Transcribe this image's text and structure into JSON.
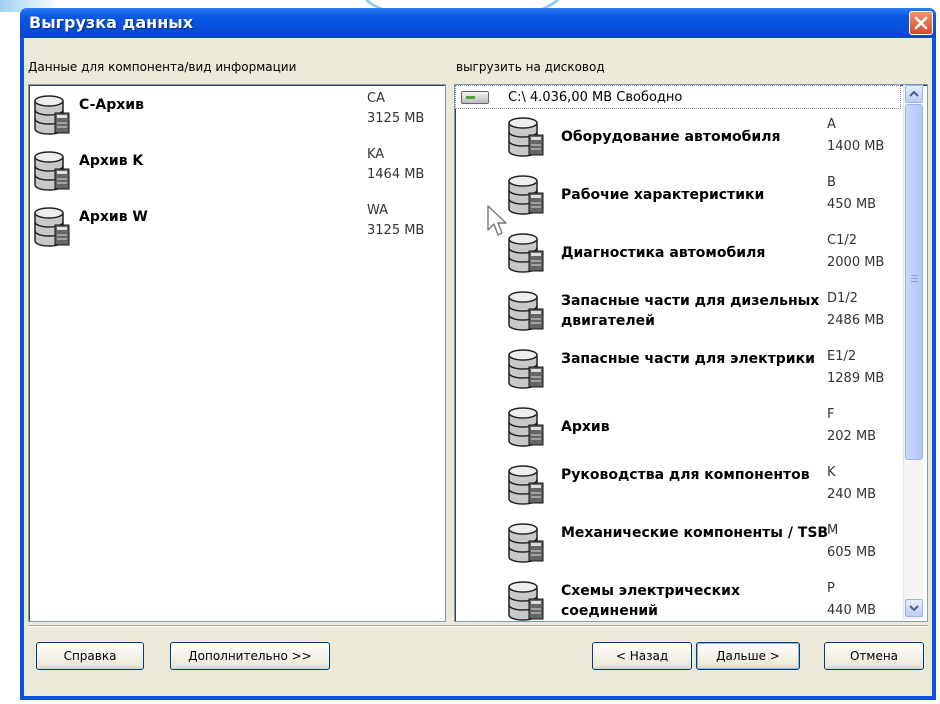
{
  "window": {
    "title": "Выгрузка данных"
  },
  "left_panel": {
    "label": "Данные для компонента/вид информации",
    "items": [
      {
        "name": "C-Архив",
        "code": "CA",
        "size": "3125 MB"
      },
      {
        "name": "Архив K",
        "code": "KA",
        "size": "1464 MB"
      },
      {
        "name": "Архив W",
        "code": "WA",
        "size": "3125 MB"
      }
    ]
  },
  "right_panel": {
    "label": "выгрузить на дисковод",
    "drive": "C:\\ 4.036,00 MB Свободно",
    "items": [
      {
        "name": "Оборудование автомобиля",
        "code": "A",
        "size": "1400 MB"
      },
      {
        "name": "Рабочие характеристики",
        "code": "B",
        "size": "450 MB"
      },
      {
        "name": "Диагностика автомобиля",
        "code": "C1/2",
        "size": "2000 MB"
      },
      {
        "name": "Запасные части для дизельных двигателей",
        "code": "D1/2",
        "size": "2486 MB"
      },
      {
        "name": "Запасные части для электрики",
        "code": "E1/2",
        "size": "1289 MB"
      },
      {
        "name": "Архив",
        "code": "F",
        "size": "202 MB"
      },
      {
        "name": "Руководства для компонентов",
        "code": "K",
        "size": "240 MB"
      },
      {
        "name": "Механические компоненты / TSB",
        "code": "M",
        "size": "605 MB"
      },
      {
        "name": "Схемы электрических соединений",
        "code": "P",
        "size": "440 MB"
      }
    ]
  },
  "buttons": {
    "help": "Справка",
    "advanced": "Дополнительно >>",
    "back": "< Назад",
    "next": "Дальше >",
    "cancel": "Отмена"
  },
  "colors": {
    "titlebar": "#0a53e0",
    "dialog_bg": "#ece9d8",
    "close_button": "#d8482a"
  },
  "icons": [
    "close-icon",
    "database-icon",
    "drive-icon",
    "scroll-up-icon",
    "scroll-down-icon",
    "mouse-cursor-icon"
  ]
}
